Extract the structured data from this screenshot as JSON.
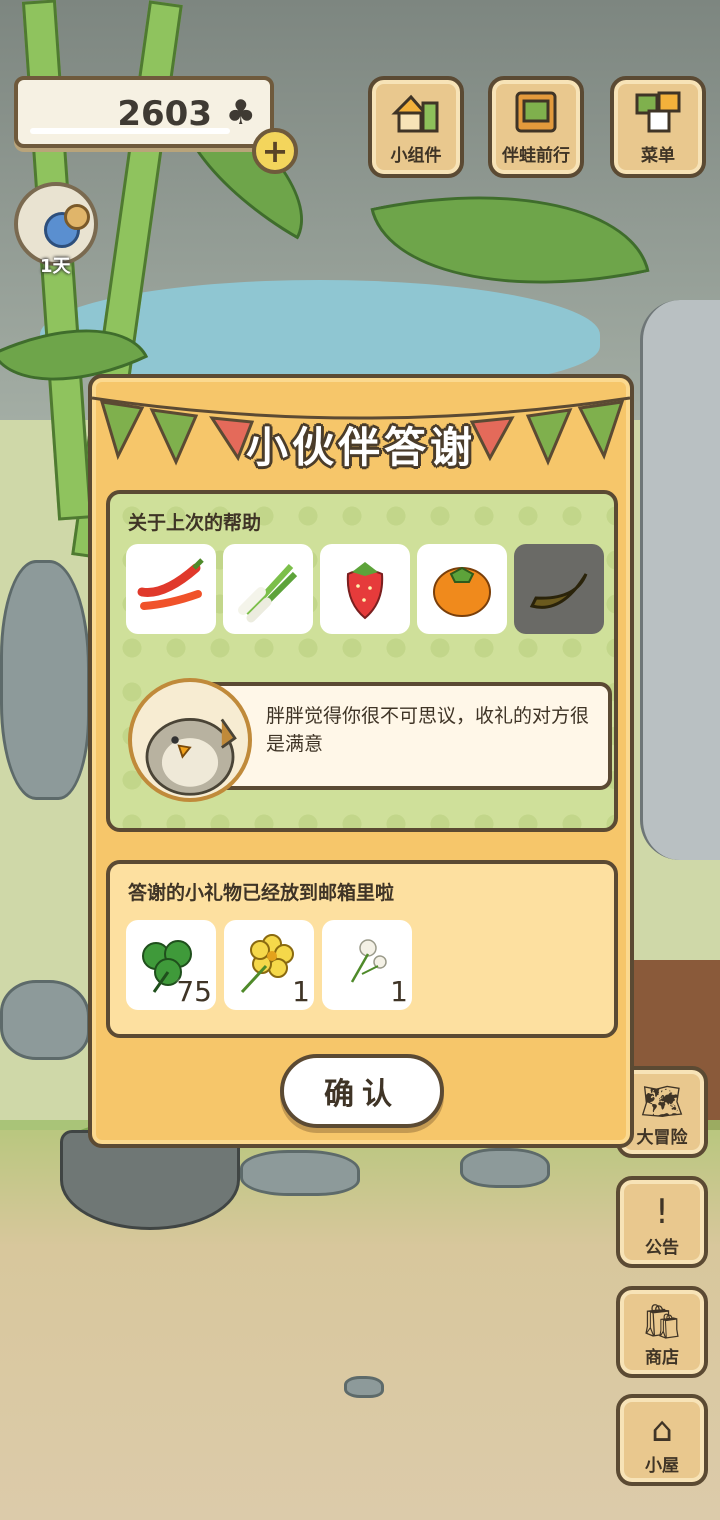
{
  "hud": {
    "clover_count": "2603",
    "clover_icon": "clover-icon",
    "plus_label": "+",
    "day_label": "1天"
  },
  "top_buttons": [
    {
      "label": "小组件",
      "icon": "widget-icon"
    },
    {
      "label": "伴蛙前行",
      "icon": "frog-journal-icon"
    },
    {
      "label": "菜单",
      "icon": "menu-icon"
    }
  ],
  "side_buttons": [
    {
      "label": "大冒险",
      "icon": "map-icon"
    },
    {
      "label": "公告",
      "icon": "exclamation-icon"
    },
    {
      "label": "商店",
      "icon": "shop-bag-icon"
    },
    {
      "label": "小屋",
      "icon": "house-icon"
    }
  ],
  "dialog": {
    "title": "小伙伴答谢",
    "help_panel": {
      "heading": "关于上次的帮助",
      "foods": [
        {
          "name": "chili-pepper-icon",
          "color": "#e0392b"
        },
        {
          "name": "green-onion-icon",
          "color": "#7cbf4a"
        },
        {
          "name": "strawberry-icon",
          "color": "#e63b3b"
        },
        {
          "name": "persimmon-icon",
          "color": "#f08a1c"
        },
        {
          "name": "banana-icon",
          "color": "#6b5a1e"
        }
      ],
      "message": "胖胖觉得你很不可思议，收礼的对方很是满意"
    },
    "gift_panel": {
      "heading": "答谢的小礼物已经放到邮箱里啦",
      "gifts": [
        {
          "name": "clover-icon",
          "count": "75"
        },
        {
          "name": "yellow-flower-icon",
          "count": "1"
        },
        {
          "name": "dandelion-icon",
          "count": "1"
        }
      ]
    },
    "confirm_label": "确认"
  },
  "colors": {
    "dialog_bg": "#f6c66a",
    "help_panel_bg": "#cfe09a",
    "gift_panel_bg": "#fde0a0",
    "outline": "#5b4a33"
  }
}
